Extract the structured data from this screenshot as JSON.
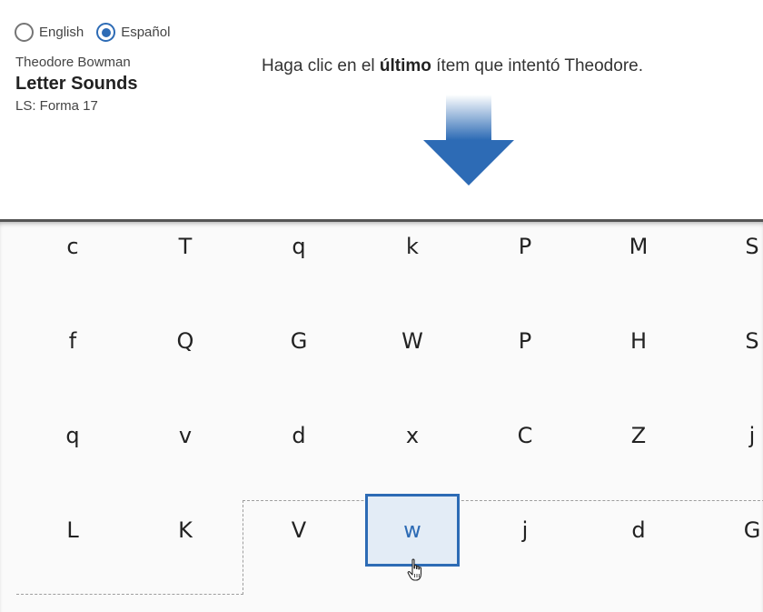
{
  "language": {
    "options": [
      {
        "label": "English",
        "selected": false
      },
      {
        "label": "Español",
        "selected": true
      }
    ]
  },
  "student": {
    "name": "Theodore Bowman"
  },
  "assessment": {
    "title": "Letter Sounds",
    "form": "LS: Forma 17"
  },
  "instruction": {
    "prefix": "Haga clic en el ",
    "emphasis": "último",
    "suffix": " ítem que intentó Theodore."
  },
  "grid": {
    "rows": [
      [
        "c",
        "T",
        "q",
        "k",
        "P",
        "M",
        "S"
      ],
      [
        "f",
        "Q",
        "G",
        "W",
        "P",
        "H",
        "S"
      ],
      [
        "q",
        "v",
        "d",
        "x",
        "C",
        "Z",
        "j"
      ],
      [
        "L",
        "K",
        "V",
        "w",
        "j",
        "d",
        "G"
      ]
    ],
    "selected": {
      "row": 3,
      "col": 3
    }
  },
  "colors": {
    "accent": "#2d6bb5",
    "selected_bg": "#e3ecf6"
  },
  "icons": {
    "arrow": "down-arrow-icon",
    "cursor": "hand-cursor-icon"
  }
}
